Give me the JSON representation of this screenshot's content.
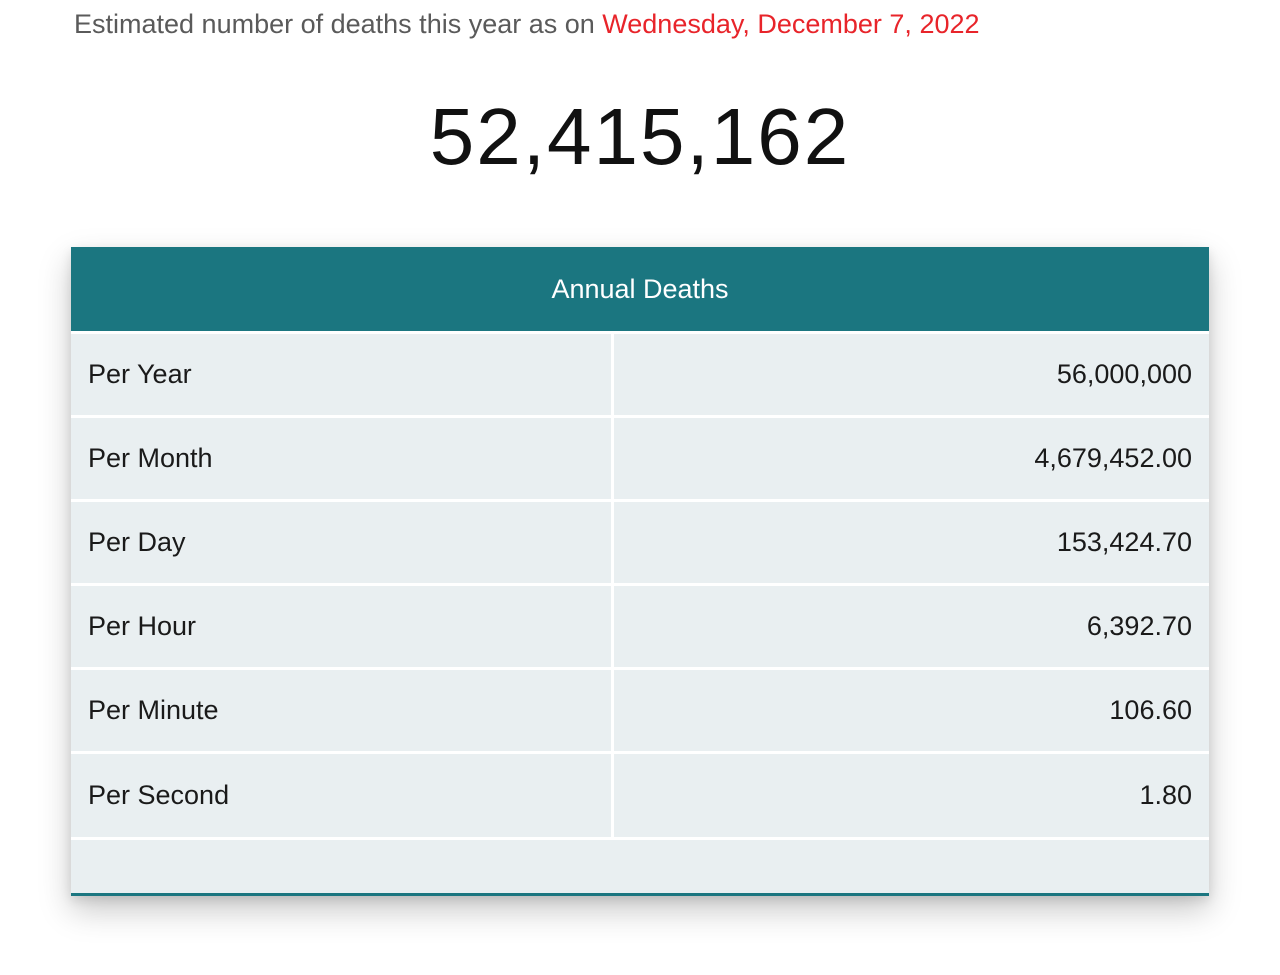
{
  "header": {
    "prefix": "Estimated number of deaths this year as on ",
    "date": "Wednesday, December 7, 2022"
  },
  "counter": {
    "value": "52,415,162"
  },
  "table": {
    "title": "Annual Deaths",
    "rows": [
      {
        "label": "Per Year",
        "value": "56,000,000"
      },
      {
        "label": "Per Month",
        "value": "4,679,452.00"
      },
      {
        "label": "Per Day",
        "value": "153,424.70"
      },
      {
        "label": "Per Hour",
        "value": "6,392.70"
      },
      {
        "label": "Per Minute",
        "value": "106.60"
      },
      {
        "label": "Per Second",
        "value": "1.80"
      }
    ]
  },
  "colors": {
    "accent": "#1b7680",
    "date_text": "#e8242a",
    "row_background": "#e9eff1"
  }
}
